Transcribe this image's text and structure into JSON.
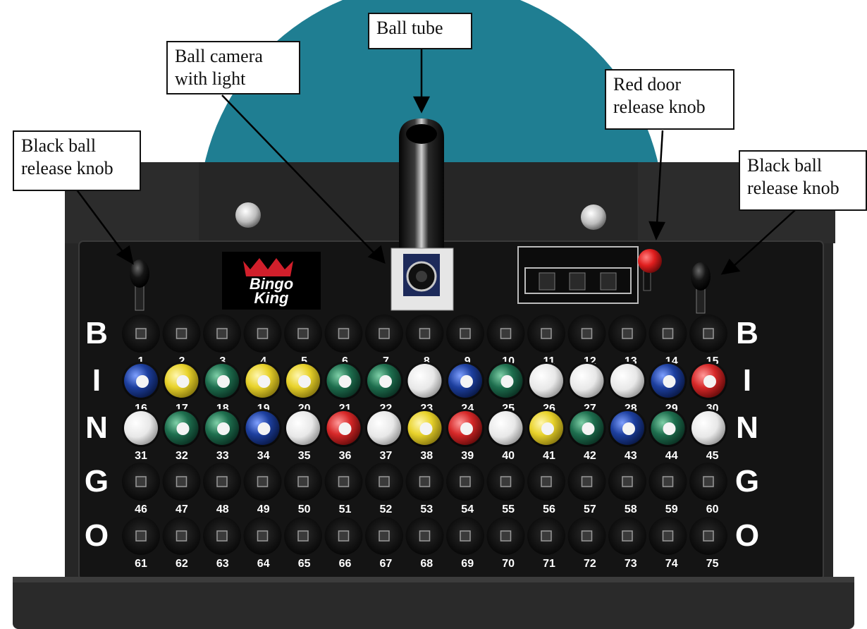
{
  "callouts": {
    "ball_tube": "Ball tube",
    "ball_camera": "Ball camera\nwith light",
    "red_door": "Red door\nrelease knob",
    "black_knob_left": "Black ball\nrelease knob",
    "black_knob_right": "Black ball\nrelease knob"
  },
  "logo": {
    "top": "Bingo",
    "bottom": "King"
  },
  "letters": [
    "B",
    "I",
    "N",
    "G",
    "O"
  ],
  "colors": {
    "teal_wheel": "#1f7e92",
    "cabinet": "#1e1e1e",
    "panel": "#141414",
    "red_knob": "#e01e1e",
    "ball_blue": "#1d3f9e",
    "ball_yellow": "#e8d22a",
    "ball_green": "#1e6e4e",
    "ball_white": "#f2f2f2",
    "ball_red": "#d62828"
  },
  "rows": [
    {
      "letter": "B",
      "numbers": [
        "1",
        "2",
        "3",
        "4",
        "5",
        "6",
        "7",
        "8",
        "9",
        "10",
        "11",
        "12",
        "13",
        "14",
        "15"
      ],
      "balls": [
        "empty",
        "empty",
        "empty",
        "empty",
        "empty",
        "empty",
        "empty",
        "empty",
        "empty",
        "empty",
        "empty",
        "empty",
        "empty",
        "empty",
        "empty"
      ]
    },
    {
      "letter": "I",
      "numbers": [
        "16",
        "17",
        "18",
        "19",
        "20",
        "21",
        "22",
        "23",
        "24",
        "25",
        "26",
        "27",
        "28",
        "29",
        "30"
      ],
      "balls": [
        "blue",
        "yellow",
        "green",
        "yellow",
        "yellow",
        "green",
        "green",
        "white",
        "blue",
        "green",
        "white",
        "white",
        "white",
        "blue",
        "red"
      ]
    },
    {
      "letter": "N",
      "numbers": [
        "31",
        "32",
        "33",
        "34",
        "35",
        "36",
        "37",
        "38",
        "39",
        "40",
        "41",
        "42",
        "43",
        "44",
        "45"
      ],
      "balls": [
        "white",
        "green",
        "green",
        "blue",
        "white",
        "red",
        "white",
        "yellow",
        "red",
        "white",
        "yellow",
        "green",
        "blue",
        "green",
        "white"
      ]
    },
    {
      "letter": "G",
      "numbers": [
        "46",
        "47",
        "48",
        "49",
        "50",
        "51",
        "52",
        "53",
        "54",
        "55",
        "56",
        "57",
        "58",
        "59",
        "60"
      ],
      "balls": [
        "empty",
        "empty",
        "empty",
        "empty",
        "empty",
        "empty",
        "empty",
        "empty",
        "empty",
        "empty",
        "empty",
        "empty",
        "empty",
        "empty",
        "empty"
      ]
    },
    {
      "letter": "O",
      "numbers": [
        "61",
        "62",
        "63",
        "64",
        "65",
        "66",
        "67",
        "68",
        "69",
        "70",
        "71",
        "72",
        "73",
        "74",
        "75"
      ],
      "balls": [
        "empty",
        "empty",
        "empty",
        "empty",
        "empty",
        "empty",
        "empty",
        "empty",
        "empty",
        "empty",
        "empty",
        "empty",
        "empty",
        "empty",
        "empty"
      ]
    }
  ]
}
